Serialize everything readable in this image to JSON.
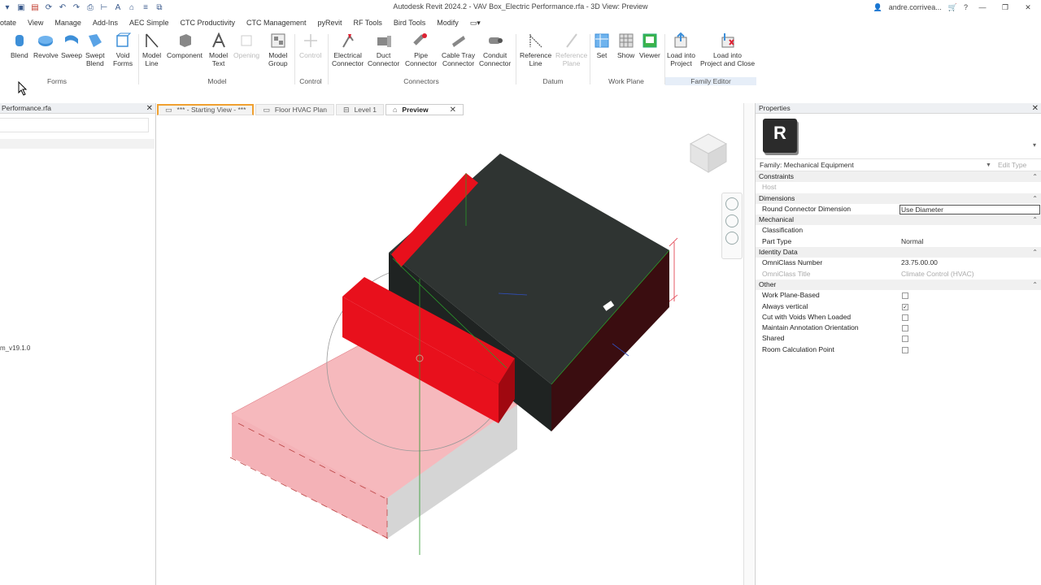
{
  "window": {
    "title": "Autodesk Revit 2024.2 - VAV Box_Electric Performance.rfa - 3D View: Preview",
    "user": "andre.corrivea..."
  },
  "menu": [
    "otate",
    "View",
    "Manage",
    "Add-Ins",
    "AEC Simple",
    "CTC Productivity",
    "CTC Management",
    "pyRevit",
    "RF Tools",
    "Bird Tools",
    "Modify"
  ],
  "ribbon": {
    "buttons": [
      {
        "id": "blend",
        "label": "Blend"
      },
      {
        "id": "revolve",
        "label": "Revolve"
      },
      {
        "id": "sweep",
        "label": "Sweep"
      },
      {
        "id": "swept_blend",
        "label": "Swept\nBlend"
      },
      {
        "id": "void_forms",
        "label": "Void\nForms"
      },
      {
        "id": "model_line",
        "label": "Model\nLine"
      },
      {
        "id": "component",
        "label": "Component"
      },
      {
        "id": "model_text",
        "label": "Model\nText"
      },
      {
        "id": "opening",
        "label": "Opening"
      },
      {
        "id": "model_group",
        "label": "Model\nGroup"
      },
      {
        "id": "control",
        "label": "Control"
      },
      {
        "id": "electrical_connector",
        "label": "Electrical\nConnector"
      },
      {
        "id": "duct_connector",
        "label": "Duct\nConnector"
      },
      {
        "id": "pipe_connector",
        "label": "Pipe\nConnector"
      },
      {
        "id": "cable_tray_connector",
        "label": "Cable Tray\nConnector"
      },
      {
        "id": "conduit_connector",
        "label": "Conduit\nConnector"
      },
      {
        "id": "reference_line",
        "label": "Reference\nLine"
      },
      {
        "id": "reference_plane",
        "label": "Reference\nPlane"
      },
      {
        "id": "set",
        "label": "Set"
      },
      {
        "id": "show",
        "label": "Show"
      },
      {
        "id": "viewer",
        "label": "Viewer"
      },
      {
        "id": "load_into_project",
        "label": "Load into\nProject"
      },
      {
        "id": "load_into_project_close",
        "label": "Load into\nProject and Close"
      }
    ],
    "panels": [
      "Forms",
      "Model",
      "Control",
      "Connectors",
      "Datum",
      "Work Plane",
      "Family Editor"
    ]
  },
  "project_browser": {
    "title": "Performance.rfa",
    "version_text": "m_v19.1.0"
  },
  "view_tabs": [
    {
      "label": "*** - Starting View - ***"
    },
    {
      "label": "Floor HVAC Plan"
    },
    {
      "label": "Level 1"
    },
    {
      "label": "Preview"
    }
  ],
  "properties": {
    "title": "Properties",
    "logo_letter": "R",
    "family": "Family: Mechanical Equipment",
    "edit_type": "Edit Type",
    "groups": {
      "constraints": "Constraints",
      "dimensions": "Dimensions",
      "mechanical": "Mechanical",
      "identity": "Identity Data",
      "other": "Other"
    },
    "rows": {
      "host": "Host",
      "round_connector_dimension": "Round Connector Dimension",
      "round_connector_value": "Use Diameter",
      "classification": "Classification",
      "part_type": "Part Type",
      "part_type_value": "Normal",
      "omniclass_number": "OmniClass Number",
      "omniclass_number_value": "23.75.00.00",
      "omniclass_title": "OmniClass Title",
      "omniclass_title_value": "Climate Control (HVAC)",
      "work_plane_based": "Work Plane-Based",
      "always_vertical": "Always vertical",
      "cut_with_voids": "Cut with Voids When Loaded",
      "maintain_annotation": "Maintain Annotation Orientation",
      "shared": "Shared",
      "room_calc_point": "Room Calculation Point"
    },
    "checks": {
      "work_plane_based": false,
      "always_vertical": true,
      "cut_with_voids": false,
      "maintain_annotation": false,
      "shared": false,
      "room_calc_point": false
    }
  },
  "colors": {
    "accent": "#f0a030",
    "model_dark": "#2f3432",
    "model_red": "#e8101c",
    "model_pink": "#f6b9bd"
  }
}
